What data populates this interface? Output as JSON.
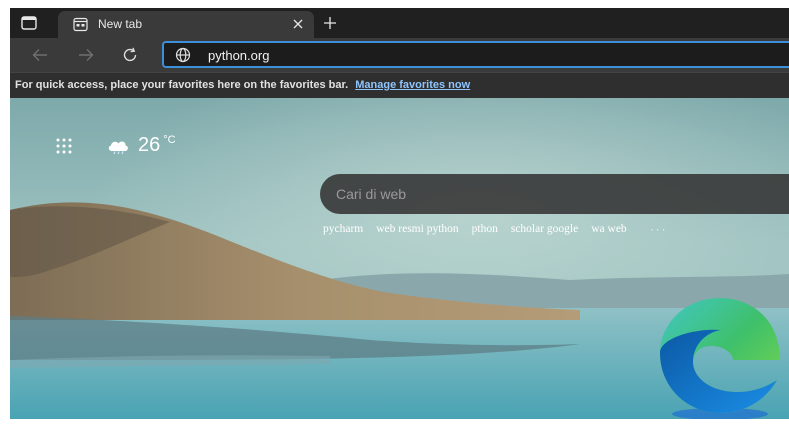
{
  "tab": {
    "title": "New tab"
  },
  "omnibox": {
    "value": "python.org"
  },
  "favorites_bar": {
    "message": "For quick access, place your favorites here on the favorites bar.",
    "link": "Manage favorites now"
  },
  "weather": {
    "temp": "26",
    "unit": "°C",
    "icon": "cloud-icon"
  },
  "search": {
    "placeholder": "Cari di web"
  },
  "suggestions": [
    "pycharm",
    "web resmi python",
    "pthon",
    "scholar google",
    "wa web"
  ],
  "more": "···",
  "colors": {
    "accent": "#3c8fd8",
    "link": "#8fc5ff",
    "toolbar": "#3a3a3a",
    "tabstrip": "#202020"
  }
}
